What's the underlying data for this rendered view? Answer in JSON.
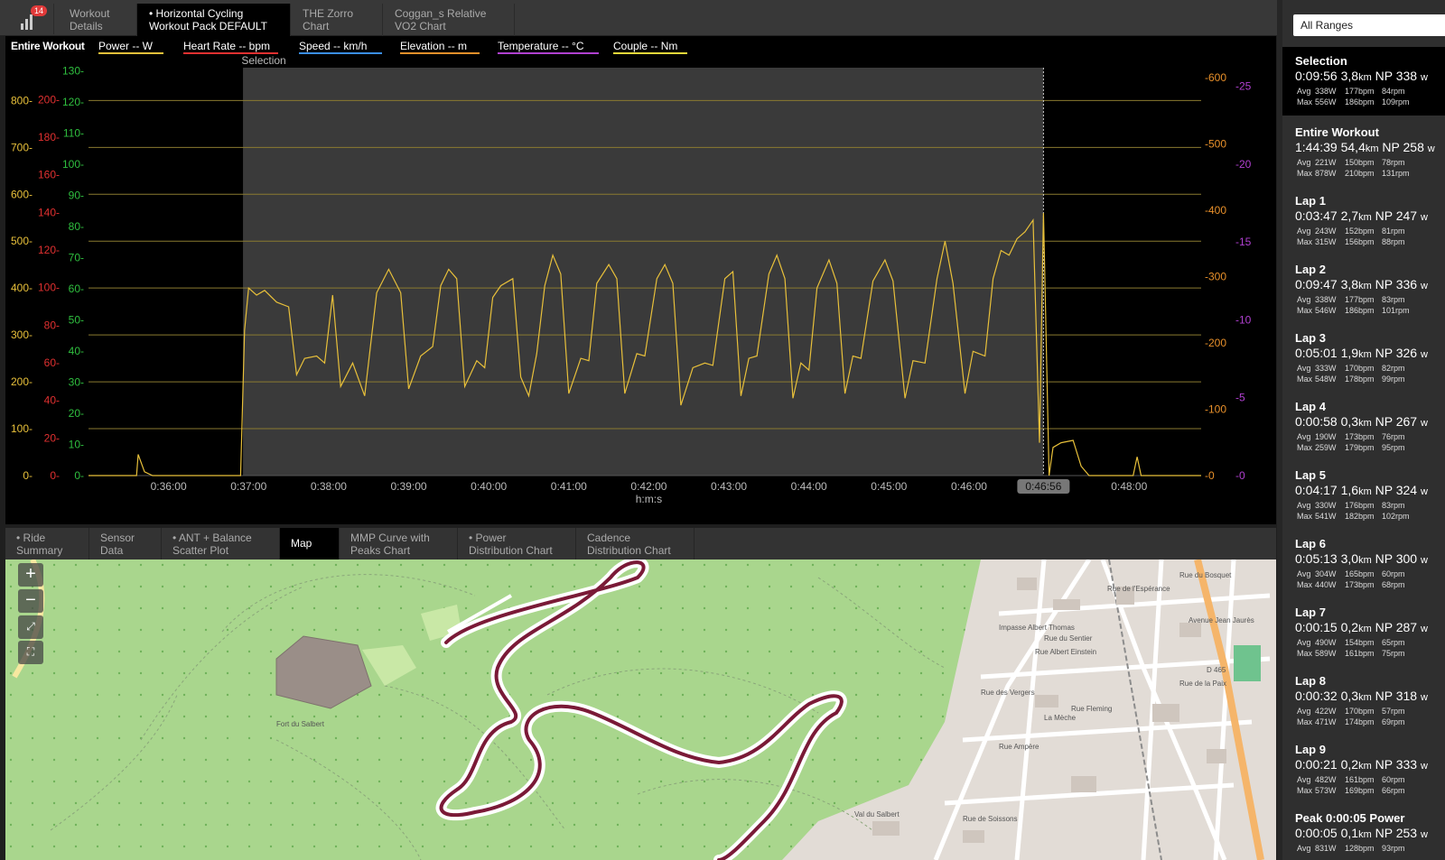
{
  "tabs_top": [
    {
      "l1": "Workout",
      "l2": "Details",
      "active": false
    },
    {
      "l1": "• Horizontal Cycling",
      "l2": "Workout Pack DEFAULT",
      "active": true
    },
    {
      "l1": "THE Zorro",
      "l2": "Chart",
      "active": false
    },
    {
      "l1": "Coggan_s Relative",
      "l2": "VO2 Chart",
      "active": false
    }
  ],
  "notification_count": "14",
  "legend": [
    {
      "label": "Entire Workout",
      "color": "#ffffff"
    },
    {
      "label": "Power  -- W",
      "color": "#e8c03a"
    },
    {
      "label": "Heart Rate  -- bpm",
      "color": "#e03030"
    },
    {
      "label": "Speed  -- km/h",
      "color": "#3a8ee8"
    },
    {
      "label": "Elevation  -- m",
      "color": "#e8902a"
    },
    {
      "label": "Temperature  -- °C",
      "color": "#b040d0"
    },
    {
      "label": "Couple  -- Nm",
      "color": "#e8d83a"
    }
  ],
  "chart_data": {
    "type": "line",
    "xlabel": "h:m:s",
    "selection_label": "Selection",
    "cursor_label": "0:46:56",
    "x_ticks": [
      "0:36:00",
      "0:37:00",
      "0:38:00",
      "0:39:00",
      "0:40:00",
      "0:41:00",
      "0:42:00",
      "0:43:00",
      "0:44:00",
      "0:45:00",
      "0:46:00",
      "0:48:00"
    ],
    "x_tick_minutes": [
      36,
      37,
      38,
      39,
      40,
      41,
      42,
      43,
      44,
      45,
      46,
      48
    ],
    "x_range_minutes": [
      35.0,
      48.9
    ],
    "selection_minutes": [
      36.93,
      46.93
    ],
    "axes": {
      "power": {
        "color": "#e8c03a",
        "ticks": [
          "800-",
          "700-",
          "600-",
          "500-",
          "400-",
          "300-",
          "200-",
          "100-",
          "0-"
        ],
        "values": [
          800,
          700,
          600,
          500,
          400,
          300,
          200,
          100,
          0
        ]
      },
      "heart_rate": {
        "color": "#e03030",
        "ticks": [
          "200-",
          "180-",
          "160-",
          "140-",
          "120-",
          "100-",
          "80-",
          "60-",
          "40-",
          "20-",
          "0-"
        ],
        "values": [
          200,
          180,
          160,
          140,
          120,
          100,
          80,
          60,
          40,
          20,
          0
        ]
      },
      "speed": {
        "color": "#2fbf3f",
        "ticks": [
          "130-",
          "120-",
          "110-",
          "100-",
          "90-",
          "80-",
          "70-",
          "60-",
          "50-",
          "40-",
          "30-",
          "20-",
          "10-",
          "0-"
        ],
        "values": [
          130,
          120,
          110,
          100,
          90,
          80,
          70,
          60,
          50,
          40,
          30,
          20,
          10,
          0
        ]
      },
      "elevation": {
        "color": "#e8902a",
        "ticks": [
          "-600",
          "-500",
          "-400",
          "-300",
          "-200",
          "-100",
          "-0"
        ],
        "values": [
          600,
          500,
          400,
          300,
          200,
          100,
          0
        ]
      },
      "temperature": {
        "color": "#b040d0",
        "ticks": [
          "-25",
          "-20",
          "-15",
          "-10",
          "-5",
          "-0"
        ],
        "values": [
          25,
          20,
          15,
          10,
          5,
          0
        ]
      }
    },
    "series": [
      {
        "name": "Power",
        "color": "#e8c03a",
        "points": [
          [
            35.0,
            0
          ],
          [
            35.6,
            0
          ],
          [
            35.62,
            45
          ],
          [
            35.7,
            8
          ],
          [
            35.8,
            0
          ],
          [
            36.9,
            0
          ],
          [
            36.95,
            310
          ],
          [
            37.0,
            400
          ],
          [
            37.1,
            385
          ],
          [
            37.2,
            395
          ],
          [
            37.35,
            370
          ],
          [
            37.5,
            360
          ],
          [
            37.6,
            215
          ],
          [
            37.7,
            250
          ],
          [
            37.85,
            255
          ],
          [
            37.95,
            240
          ],
          [
            38.05,
            385
          ],
          [
            38.15,
            190
          ],
          [
            38.3,
            240
          ],
          [
            38.45,
            170
          ],
          [
            38.6,
            390
          ],
          [
            38.75,
            440
          ],
          [
            38.9,
            390
          ],
          [
            39.0,
            185
          ],
          [
            39.15,
            255
          ],
          [
            39.3,
            275
          ],
          [
            39.4,
            405
          ],
          [
            39.5,
            440
          ],
          [
            39.6,
            420
          ],
          [
            39.7,
            190
          ],
          [
            39.85,
            245
          ],
          [
            39.95,
            230
          ],
          [
            40.05,
            380
          ],
          [
            40.15,
            405
          ],
          [
            40.3,
            420
          ],
          [
            40.4,
            210
          ],
          [
            40.5,
            170
          ],
          [
            40.6,
            260
          ],
          [
            40.7,
            405
          ],
          [
            40.8,
            470
          ],
          [
            40.9,
            430
          ],
          [
            41.0,
            175
          ],
          [
            41.15,
            250
          ],
          [
            41.25,
            245
          ],
          [
            41.35,
            410
          ],
          [
            41.5,
            450
          ],
          [
            41.6,
            420
          ],
          [
            41.7,
            175
          ],
          [
            41.85,
            260
          ],
          [
            41.95,
            255
          ],
          [
            42.1,
            420
          ],
          [
            42.2,
            450
          ],
          [
            42.3,
            410
          ],
          [
            42.4,
            150
          ],
          [
            42.55,
            230
          ],
          [
            42.7,
            240
          ],
          [
            42.8,
            235
          ],
          [
            42.95,
            420
          ],
          [
            43.05,
            435
          ],
          [
            43.15,
            170
          ],
          [
            43.25,
            250
          ],
          [
            43.35,
            255
          ],
          [
            43.5,
            430
          ],
          [
            43.6,
            470
          ],
          [
            43.7,
            420
          ],
          [
            43.8,
            165
          ],
          [
            43.9,
            240
          ],
          [
            44.0,
            225
          ],
          [
            44.1,
            400
          ],
          [
            44.25,
            460
          ],
          [
            44.35,
            410
          ],
          [
            44.45,
            175
          ],
          [
            44.55,
            255
          ],
          [
            44.65,
            250
          ],
          [
            44.8,
            415
          ],
          [
            44.95,
            460
          ],
          [
            45.05,
            415
          ],
          [
            45.2,
            165
          ],
          [
            45.3,
            245
          ],
          [
            45.45,
            240
          ],
          [
            45.6,
            420
          ],
          [
            45.7,
            500
          ],
          [
            45.8,
            410
          ],
          [
            45.95,
            175
          ],
          [
            46.05,
            265
          ],
          [
            46.2,
            255
          ],
          [
            46.3,
            420
          ],
          [
            46.4,
            480
          ],
          [
            46.5,
            470
          ],
          [
            46.6,
            505
          ],
          [
            46.7,
            520
          ],
          [
            46.8,
            545
          ],
          [
            46.88,
            70
          ],
          [
            46.93,
            560
          ],
          [
            47.0,
            0
          ],
          [
            47.05,
            60
          ],
          [
            47.15,
            70
          ],
          [
            47.3,
            75
          ],
          [
            47.4,
            20
          ],
          [
            47.5,
            0
          ],
          [
            48.05,
            0
          ],
          [
            48.1,
            40
          ],
          [
            48.15,
            0
          ],
          [
            48.9,
            0
          ]
        ]
      }
    ]
  },
  "tabs_bottom": [
    {
      "l1": "• Ride",
      "l2": "Summary",
      "active": false
    },
    {
      "l1": "Sensor",
      "l2": "Data",
      "active": false
    },
    {
      "l1": "• ANT + Balance",
      "l2": "Scatter Plot",
      "active": false
    },
    {
      "l1": "Map",
      "l2": "",
      "active": true
    },
    {
      "l1": "MMP Curve with",
      "l2": "Peaks Chart",
      "active": false
    },
    {
      "l1": "• Power",
      "l2": "Distribution Chart",
      "active": false
    },
    {
      "l1": "Cadence",
      "l2": "Distribution Chart",
      "active": false
    }
  ],
  "map": {
    "zoom_in": "+",
    "zoom_out": "−",
    "labels": [
      "Impasse Albert Thomas",
      "Rue de l'Espérance",
      "Rue Albert Einstein",
      "Rue du Bosquet",
      "Rue du Sentier",
      "Rue des Vergers",
      "La Mèche",
      "Rue de la Paix",
      "Rue Fleming",
      "Rue Ampère",
      "D 465",
      "Val du Salbert",
      "Rue de Soissons",
      "Fort du Salbert",
      "Avenue Jean Jaurès"
    ]
  },
  "range_select": "All Ranges",
  "stats": [
    {
      "name": "Selection",
      "time": "0:09:56",
      "dist": "3,8",
      "np": "NP 338",
      "avg_w": "338W",
      "avg_hr": "177bpm",
      "avg_rpm": "84rpm",
      "max_w": "556W",
      "max_hr": "186bpm",
      "max_rpm": "109rpm",
      "selected": true
    },
    {
      "name": "Entire Workout",
      "time": "1:44:39",
      "dist": "54,4",
      "np": "NP 258",
      "avg_w": "221W",
      "avg_hr": "150bpm",
      "avg_rpm": "78rpm",
      "max_w": "878W",
      "max_hr": "210bpm",
      "max_rpm": "131rpm"
    },
    {
      "name": "Lap 1",
      "time": "0:03:47",
      "dist": "2,7",
      "np": "NP 247",
      "avg_w": "243W",
      "avg_hr": "152bpm",
      "avg_rpm": "81rpm",
      "max_w": "315W",
      "max_hr": "156bpm",
      "max_rpm": "88rpm"
    },
    {
      "name": "Lap 2",
      "time": "0:09:47",
      "dist": "3,8",
      "np": "NP 336",
      "avg_w": "338W",
      "avg_hr": "177bpm",
      "avg_rpm": "83rpm",
      "max_w": "546W",
      "max_hr": "186bpm",
      "max_rpm": "101rpm"
    },
    {
      "name": "Lap 3",
      "time": "0:05:01",
      "dist": "1,9",
      "np": "NP 326",
      "avg_w": "333W",
      "avg_hr": "170bpm",
      "avg_rpm": "82rpm",
      "max_w": "548W",
      "max_hr": "178bpm",
      "max_rpm": "99rpm"
    },
    {
      "name": "Lap 4",
      "time": "0:00:58",
      "dist": "0,3",
      "np": "NP 267",
      "avg_w": "190W",
      "avg_hr": "173bpm",
      "avg_rpm": "76rpm",
      "max_w": "259W",
      "max_hr": "179bpm",
      "max_rpm": "95rpm"
    },
    {
      "name": "Lap 5",
      "time": "0:04:17",
      "dist": "1,6",
      "np": "NP 324",
      "avg_w": "330W",
      "avg_hr": "176bpm",
      "avg_rpm": "83rpm",
      "max_w": "541W",
      "max_hr": "182bpm",
      "max_rpm": "102rpm"
    },
    {
      "name": "Lap 6",
      "time": "0:05:13",
      "dist": "3,0",
      "np": "NP 300",
      "avg_w": "304W",
      "avg_hr": "165bpm",
      "avg_rpm": "60rpm",
      "max_w": "440W",
      "max_hr": "173bpm",
      "max_rpm": "68rpm"
    },
    {
      "name": "Lap 7",
      "time": "0:00:15",
      "dist": "0,2",
      "np": "NP 287",
      "avg_w": "490W",
      "avg_hr": "154bpm",
      "avg_rpm": "65rpm",
      "max_w": "589W",
      "max_hr": "161bpm",
      "max_rpm": "75rpm"
    },
    {
      "name": "Lap 8",
      "time": "0:00:32",
      "dist": "0,3",
      "np": "NP 318",
      "avg_w": "422W",
      "avg_hr": "170bpm",
      "avg_rpm": "57rpm",
      "max_w": "471W",
      "max_hr": "174bpm",
      "max_rpm": "69rpm"
    },
    {
      "name": "Lap 9",
      "time": "0:00:21",
      "dist": "0,2",
      "np": "NP 333",
      "avg_w": "482W",
      "avg_hr": "161bpm",
      "avg_rpm": "60rpm",
      "max_w": "573W",
      "max_hr": "169bpm",
      "max_rpm": "66rpm"
    },
    {
      "name": "Peak 0:00:05 Power",
      "time": "0:00:05",
      "dist": "0,1",
      "np": "NP 253",
      "avg_w": "831W",
      "avg_hr": "128bpm",
      "avg_rpm": "93rpm",
      "max_w": "",
      "max_hr": "",
      "max_rpm": ""
    }
  ],
  "units": {
    "km": "km",
    "w": "w",
    "avg": "Avg",
    "max": "Max"
  }
}
